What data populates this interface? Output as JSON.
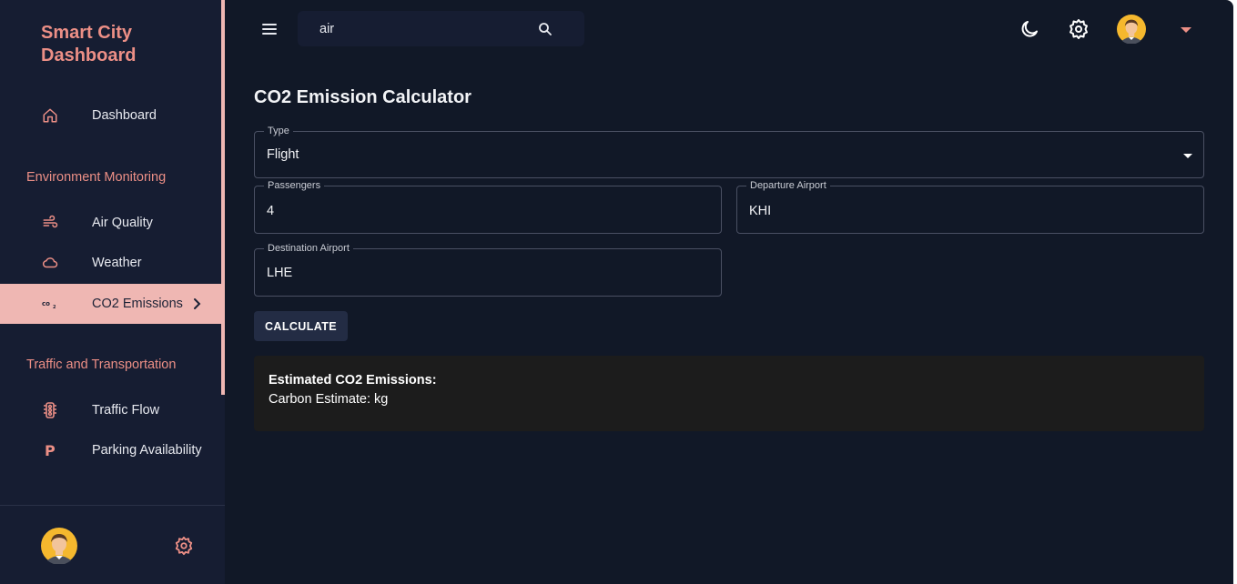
{
  "sidebar": {
    "brand_line1": "Smart City",
    "brand_line2": "Dashboard",
    "dashboard_label": "Dashboard",
    "section_environment": "Environment Monitoring",
    "air_quality_label": "Air Quality",
    "weather_label": "Weather",
    "co2_label": "CO2 Emissions",
    "section_traffic": "Traffic and Transportation",
    "traffic_flow_label": "Traffic Flow",
    "parking_label": "Parking Availability",
    "active_item": "CO2 Emissions"
  },
  "topbar": {
    "search_value": "air"
  },
  "main": {
    "title": "CO2 Emission Calculator",
    "type_label": "Type",
    "type_value": "Flight",
    "passengers_label": "Passengers",
    "passengers_value": "4",
    "departure_label": "Departure Airport",
    "departure_value": "KHI",
    "destination_label": "Destination Airport",
    "destination_value": "LHE",
    "calculate_label": "CALCULATE",
    "result_title": "Estimated CO2 Emissions:",
    "result_line": "Carbon Estimate: kg"
  },
  "colors": {
    "background": "#111827",
    "sidebar": "#161d32",
    "accent": "#ec8f86",
    "active_bg": "#efb7b3",
    "button_bg": "#232c44",
    "result_bg": "#1c1c1c"
  },
  "icons": [
    "menu-icon",
    "search-icon",
    "moon-icon",
    "gear-icon",
    "avatar",
    "home-icon",
    "wind-icon",
    "cloud-icon",
    "co2-icon",
    "chevron-right-icon",
    "traffic-light-icon",
    "parking-icon"
  ]
}
